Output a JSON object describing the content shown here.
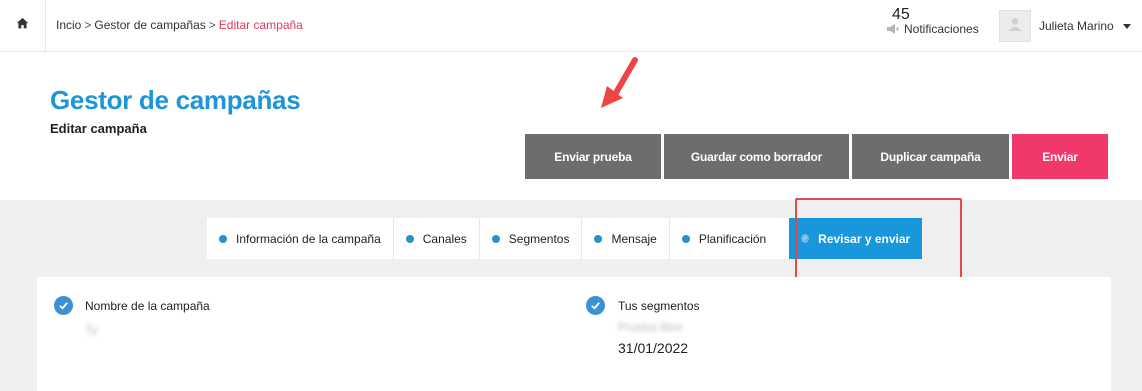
{
  "topbar": {
    "breadcrumb": {
      "home": "Incio",
      "section": "Gestor de campañas",
      "current": "Editar campaña",
      "separator": ">"
    },
    "notifications": {
      "count": "45",
      "label": "Notificaciones"
    },
    "user": {
      "name": "Julieta Marino"
    }
  },
  "header": {
    "title": "Gestor de campañas",
    "subtitle": "Editar campaña",
    "buttons": {
      "send_test": "Enviar prueba",
      "save_draft": "Guardar como borrador",
      "duplicate": "Duplicar campaña",
      "send": "Enviar"
    }
  },
  "tabs": [
    {
      "label": "Información de la campaña"
    },
    {
      "label": "Canales"
    },
    {
      "label": "Segmentos"
    },
    {
      "label": "Mensaje"
    },
    {
      "label": "Planificación"
    },
    {
      "label": "Revisar y enviar",
      "active": true
    }
  ],
  "review": {
    "campaign_name_label": "Nombre de la campaña",
    "campaign_name_value": "Ty",
    "segments_label": "Tus segmentos",
    "segments_value": "Prueba libre",
    "date_value": "31/01/2022"
  },
  "colors": {
    "accent": "#1d96d9",
    "send_button": "#f0386a",
    "gray_button": "#6d6d6d",
    "active_tab": "#1997dc",
    "annotation": "#e04a4a"
  },
  "icons": {
    "home": "home-icon",
    "notifications": "megaphone-icon",
    "avatar": "user-icon",
    "check": "check-circle-icon"
  }
}
